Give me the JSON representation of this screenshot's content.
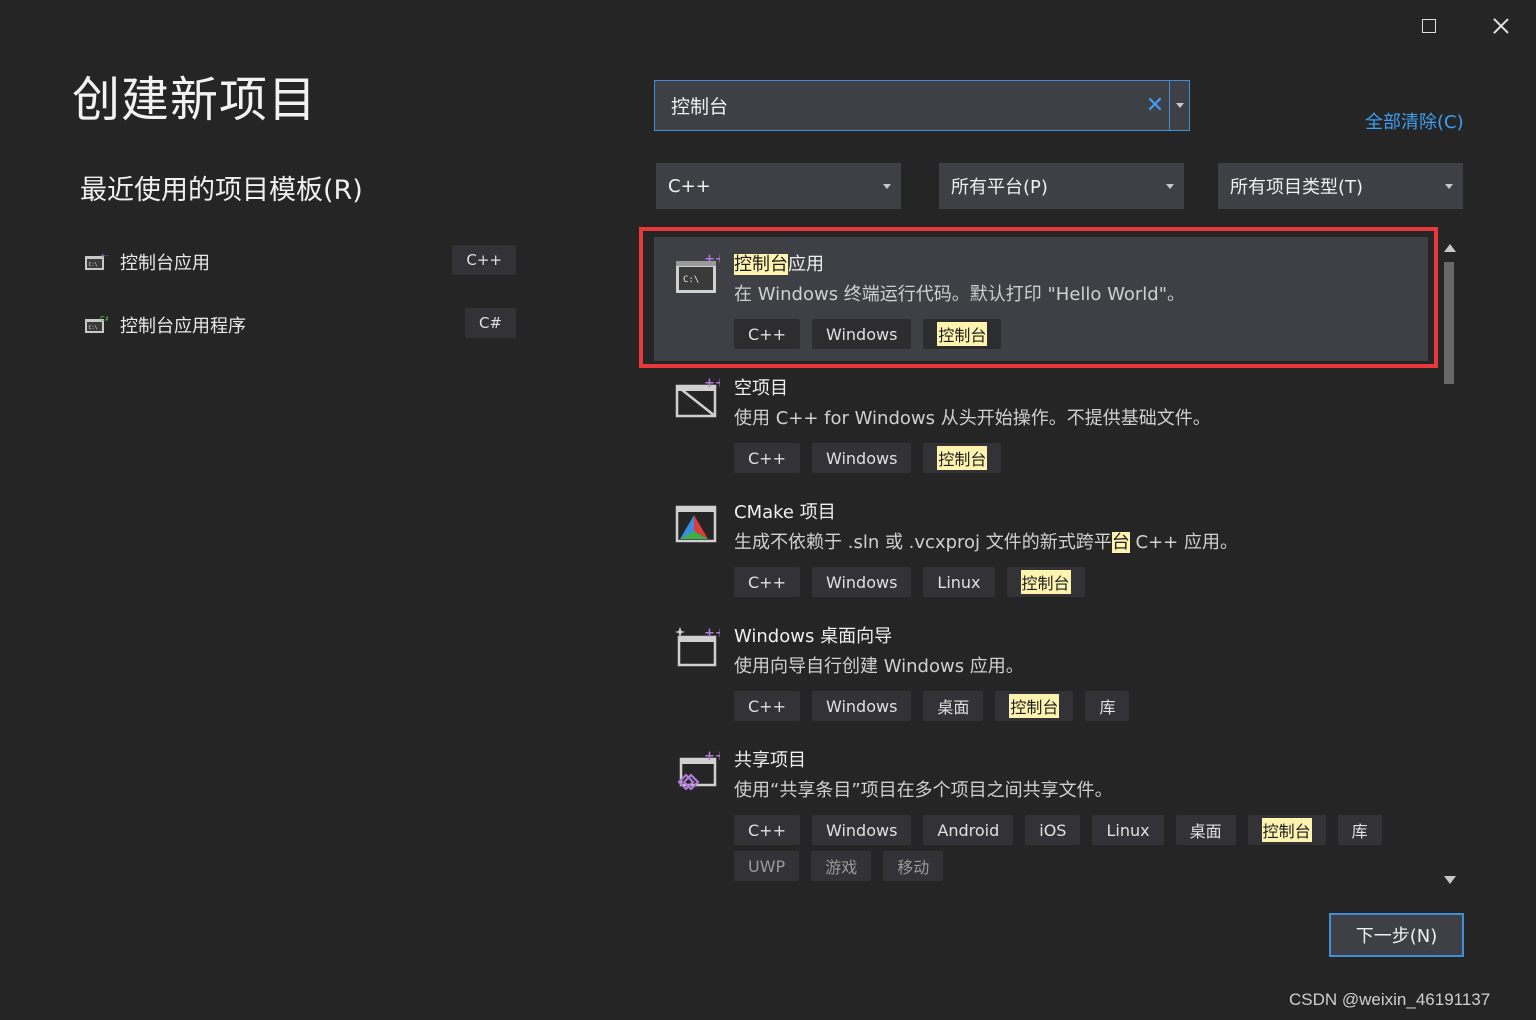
{
  "window": {
    "maximize_icon": "maximize-icon",
    "close_icon": "close-icon"
  },
  "page_title": "创建新项目",
  "recent": {
    "heading": "最近使用的项目模板(R)",
    "items": [
      {
        "label": "控制台应用",
        "badge": "C++",
        "icon": "console-app-icon"
      },
      {
        "label": "控制台应用程序",
        "badge": "C#",
        "icon": "console-app-csharp-icon"
      }
    ]
  },
  "search": {
    "value": "控制台",
    "clear_icon": "clear-icon",
    "dropdown_icon": "chevron-down-icon"
  },
  "clear_all_label": "全部清除(C)",
  "filters": [
    {
      "label": "C++"
    },
    {
      "label": "所有平台(P)"
    },
    {
      "label": "所有项目类型(T)"
    }
  ],
  "templates": [
    {
      "name_hl": "控制台",
      "name_rest": "应用",
      "description": "在 Windows 终端运行代码。默认打印 \"Hello World\"。",
      "tags": [
        "C++",
        "Windows"
      ],
      "tag_hl": "控制台",
      "icon": "console-app-icon",
      "selected": true
    },
    {
      "name": "空项目",
      "description": "使用 C++ for Windows 从头开始操作。不提供基础文件。",
      "tags": [
        "C++",
        "Windows"
      ],
      "tag_hl": "控制台",
      "icon": "empty-project-icon"
    },
    {
      "name": "CMake 项目",
      "description_pre": "生成不依赖于 .sln 或 .vcxproj 文件的新式跨平",
      "description_hl": "台",
      "description_post": " C++ 应用。",
      "tags": [
        "C++",
        "Windows",
        "Linux"
      ],
      "tag_hl": "控制台",
      "icon": "cmake-icon"
    },
    {
      "name": "Windows 桌面向导",
      "description": "使用向导自行创建 Windows 应用。",
      "tags": [
        "C++",
        "Windows",
        "桌面"
      ],
      "tag_hl": "控制台",
      "tags_after": [
        "库"
      ],
      "icon": "desktop-wizard-icon"
    },
    {
      "name": "共享项目",
      "description": "使用“共享条目”项目在多个项目之间共享文件。",
      "tags": [
        "C++",
        "Windows",
        "Android",
        "iOS",
        "Linux",
        "桌面"
      ],
      "tag_hl": "控制台",
      "tags_after": [
        "库"
      ],
      "tags_row2": [
        "UWP",
        "游戏",
        "移动"
      ],
      "icon": "shared-project-icon"
    }
  ],
  "next_button": "下一步(N)",
  "watermark": "CSDN @weixin_46191137",
  "colors": {
    "background": "#252526",
    "accent": "#3e8ed8",
    "highlight": "#fff3b0",
    "selection_outline": "#e8383b"
  }
}
